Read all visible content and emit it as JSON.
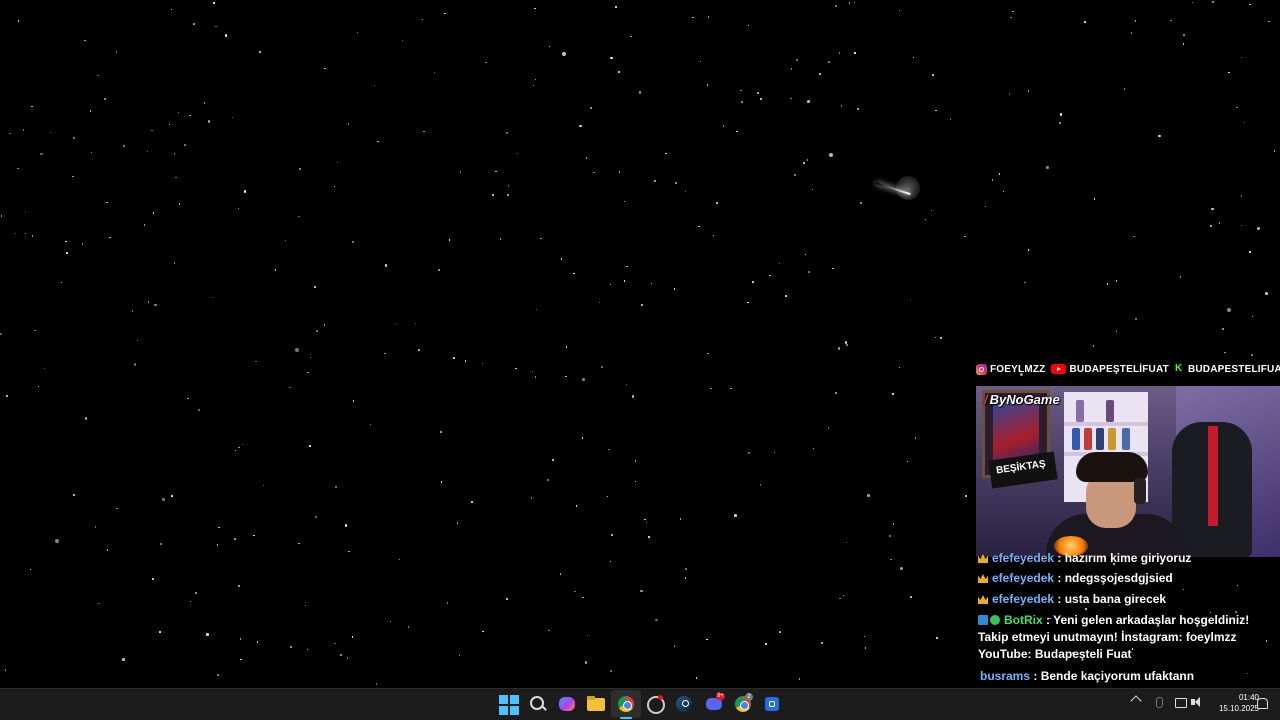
{
  "social": {
    "instagram": "FOEYLMZZ",
    "youtube": "BUDAPEŞTELİFUAT",
    "kick": "BUDAPESTELIFUAT"
  },
  "webcam": {
    "watermark": "ByNoGame",
    "flag_text": "BEŞİKTAŞ"
  },
  "chat": {
    "messages": [
      {
        "user": "efefeyedek",
        "text": "hazırım kime giriyoruz"
      },
      {
        "user": "efefeyedek",
        "text": "ndegsşojesdgjsied"
      },
      {
        "user": "efefeyedek",
        "text": "usta bana girecek"
      },
      {
        "user": "BotRix",
        "text": "Yeni gelen arkadaşlar hoşgeldiniz! Takip etmeyi unutmayın! İnstagram: foeylmzz YouTube: Budapeşteli Fuat"
      },
      {
        "user": "busrams",
        "text": "Bende kaçiyorum ufaktann"
      }
    ]
  },
  "taskbar": {
    "time": "01:40",
    "date": "15.10.2025",
    "discord_badge": "9+",
    "chrome_badge": "2",
    "icons": [
      "windows-start-icon",
      "search-icon",
      "copilot-icon",
      "file-explorer-icon",
      "chrome-icon",
      "obs-icon",
      "steam-icon",
      "discord-icon",
      "chrome-icon",
      "app-icon"
    ]
  },
  "colors": {
    "accent": "#4cc2ff",
    "chat_user": "#6fb4ff",
    "bot_user": "#3fe06a",
    "sub_badge": "#e8b021"
  }
}
